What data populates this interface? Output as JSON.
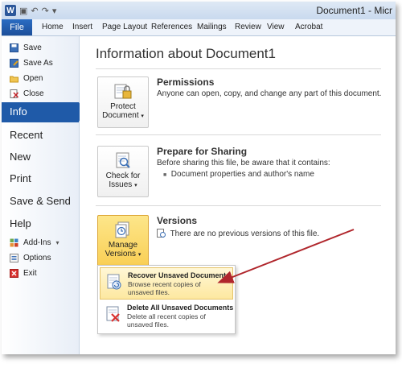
{
  "titlebar": {
    "doc_title": "Document1 - Micr"
  },
  "ribbon": {
    "file": "File",
    "tabs": [
      "Home",
      "Insert",
      "Page Layout",
      "References",
      "Mailings",
      "Review",
      "View",
      "Acrobat"
    ]
  },
  "sidebar": {
    "small_top": [
      "Save",
      "Save As",
      "Open",
      "Close"
    ],
    "info": "Info",
    "big": [
      "Recent",
      "New",
      "Print",
      "Save & Send",
      "Help"
    ],
    "small_bottom": [
      "Add-Ins",
      "Options",
      "Exit"
    ]
  },
  "main": {
    "heading": "Information about Document1",
    "permissions": {
      "button_line1": "Protect",
      "button_line2": "Document",
      "title": "Permissions",
      "text": "Anyone can open, copy, and change any part of this document."
    },
    "sharing": {
      "button_line1": "Check for",
      "button_line2": "Issues",
      "title": "Prepare for Sharing",
      "text": "Before sharing this file, be aware that it contains:",
      "bullet": "Document properties and author's name"
    },
    "versions": {
      "button_line1": "Manage",
      "button_line2": "Versions",
      "title": "Versions",
      "text": "There are no previous versions of this file."
    }
  },
  "dropdown": {
    "items": [
      {
        "title": "Recover Unsaved Documents",
        "desc": "Browse recent copies of unsaved files."
      },
      {
        "title": "Delete All Unsaved Documents",
        "desc": "Delete all recent copies of unsaved files."
      }
    ]
  },
  "colors": {
    "accent": "#1f5aa8",
    "highlight": "#f9cf55",
    "arrow": "#b0262c"
  }
}
